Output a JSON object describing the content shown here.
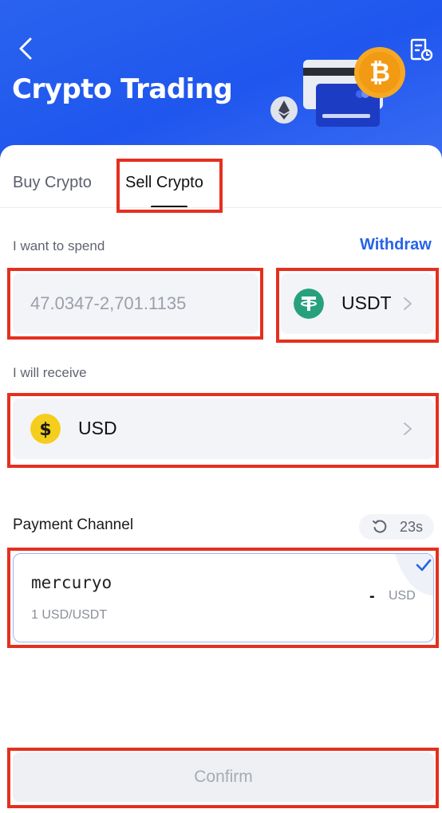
{
  "header": {
    "title": "Crypto Trading",
    "back_icon": "chevron-left-icon",
    "history_icon": "document-clock-icon"
  },
  "tabs": [
    {
      "label": "Buy Crypto",
      "active": false
    },
    {
      "label": "Sell Crypto",
      "active": true
    }
  ],
  "spend": {
    "label": "I want to spend",
    "withdraw_label": "Withdraw",
    "amount_placeholder": "47.0347-2,701.1135",
    "amount_value": "",
    "coin": "USDT",
    "coin_icon": "tether-icon"
  },
  "receive": {
    "label": "I will receive",
    "currency": "USD",
    "currency_icon": "dollar-coin-icon"
  },
  "payment": {
    "title": "Payment Channel",
    "timer": "23s",
    "channel": {
      "name": "mercuryo",
      "rate": "1 USD/USDT",
      "amount": "-",
      "currency": "USD",
      "selected": true
    }
  },
  "confirm_label": "Confirm",
  "colors": {
    "header_blue": "#2a63ee",
    "link_blue": "#2663e8",
    "tether_green": "#26a17b",
    "dollar_yellow": "#f5cd1c",
    "bitcoin_orange": "#f7a823",
    "highlight_red": "#e4301f"
  }
}
